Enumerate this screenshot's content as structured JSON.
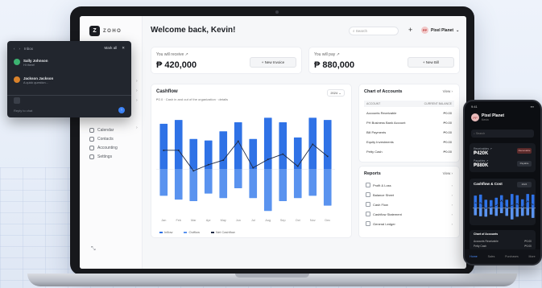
{
  "app": {
    "logo_text": "ZOHO",
    "welcome": "Welcome back, Kevin!",
    "search_placeholder": "Search",
    "org_initials": "PP",
    "org_name": "Pixel Planet"
  },
  "sidebar": {
    "items": [
      {
        "label": "Calendar"
      },
      {
        "label": "Contacts"
      },
      {
        "label": "Accounting"
      },
      {
        "label": "Settings"
      }
    ]
  },
  "stats": {
    "receive_label": "You will receive ↗",
    "receive_value": "₱ 420,000",
    "receive_button": "+ New Invoice",
    "pay_label": "You will pay ↗",
    "pay_value": "₱ 880,000",
    "pay_button": "+ New Bill"
  },
  "cashflow": {
    "title": "Cashflow",
    "subtitle": "₱2.0 · Cash in and out of the organization · details",
    "select": "2024",
    "legend": [
      "Inflow",
      "Outflow",
      "Net Cashflow"
    ]
  },
  "chart_data": {
    "type": "bar",
    "categories": [
      "Jan",
      "Feb",
      "Mar",
      "Apr",
      "May",
      "Jun",
      "Jul",
      "Aug",
      "Sep",
      "Oct",
      "Nov",
      "Dec"
    ],
    "series": [
      {
        "name": "Inflow",
        "values": [
          60,
          65,
          40,
          38,
          50,
          62,
          40,
          68,
          62,
          42,
          68,
          65
        ]
      },
      {
        "name": "Outflow",
        "values": [
          -35,
          -40,
          -42,
          -32,
          -38,
          -25,
          -38,
          -55,
          -42,
          -38,
          -35,
          -48
        ]
      },
      {
        "name": "Net Cashflow",
        "values": [
          25,
          25,
          -2,
          6,
          12,
          37,
          2,
          13,
          20,
          4,
          33,
          17
        ]
      }
    ],
    "colors": {
      "Inflow": "#2f72e6",
      "Outflow": "#5a93ef",
      "Net Cashflow": "#1f2a44"
    },
    "ylim": [
      -60,
      80
    ]
  },
  "accounts": {
    "title": "Chart of Accounts",
    "link": "View ›",
    "header_left": "ACCOUNT",
    "header_right": "CURRENT BALANCE",
    "rows": [
      {
        "name": "Accounts Receivable",
        "value": "₱0.00"
      },
      {
        "name": "PH Business Bank Account",
        "value": "₱0.00"
      },
      {
        "name": "Bill Payments",
        "value": "₱0.00"
      },
      {
        "name": "Equity Investments",
        "value": "₱0.00"
      },
      {
        "name": "Petty Cash",
        "value": "₱0.00"
      }
    ]
  },
  "reports": {
    "title": "Reports",
    "link": "View ›",
    "items": [
      {
        "label": "Profit & Loss"
      },
      {
        "label": "Balance Sheet"
      },
      {
        "label": "Cash Flow"
      },
      {
        "label": "Cashflow Statement"
      },
      {
        "label": "General Ledger"
      }
    ]
  },
  "chat": {
    "header": "Inbox",
    "header_right": "Mark all",
    "messages": [
      {
        "name": "Sally Johnson",
        "text": "Hi there!",
        "color": "#3cb371"
      },
      {
        "name": "Jackson Jackson",
        "text": "A quick question...",
        "color": "#d9822b"
      }
    ],
    "input_placeholder": "Reply to chat"
  },
  "phone": {
    "time": "9:41",
    "org_name": "Pixel Planet",
    "org_sub": "Kevin",
    "search_placeholder": "Search",
    "receivables_label": "Receivables ↗",
    "receivables_value": "₱420K",
    "payables_label": "Payables ↗",
    "payables_value": "₱880K",
    "pill_receive": "Receivable",
    "pill_pay": "Payable",
    "cashflow_title": "Cashflow & Cost",
    "cashflow_select": "2024",
    "accounts_title": "Chart of Accounts",
    "accounts_rows": [
      {
        "name": "Accounts Receivable",
        "value": "₱0.00"
      },
      {
        "name": "Petty Cash",
        "value": "₱0.00"
      }
    ],
    "nav": [
      "Home",
      "Sales",
      "Purchases",
      "More"
    ]
  }
}
